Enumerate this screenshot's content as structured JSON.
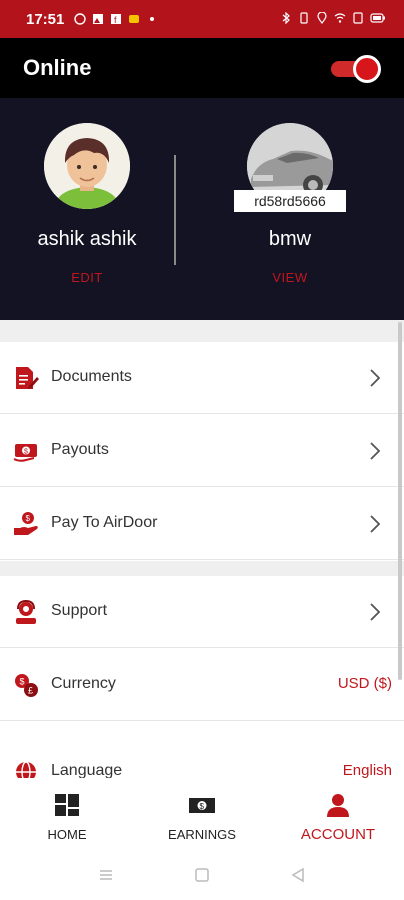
{
  "status_bar": {
    "time": "17:51",
    "left_icons": [
      "whatsapp-icon",
      "photos-icon",
      "facebook-icon",
      "message-icon",
      "dot-icon"
    ],
    "right_icons": [
      "bluetooth-icon",
      "vibrate-icon",
      "location-icon",
      "wifi-icon",
      "sim-icon",
      "battery-icon"
    ]
  },
  "header": {
    "title": "Online",
    "online_toggle": true
  },
  "profile": {
    "user_name": "ashik ashik",
    "edit_label": "EDIT",
    "car_name": "bmw",
    "plate_number": "rd58rd5666",
    "view_label": "VIEW"
  },
  "menu": {
    "group1": [
      {
        "label": "Documents",
        "icon": "document-edit-icon"
      },
      {
        "label": "Payouts",
        "icon": "payout-money-icon"
      },
      {
        "label": "Pay To AirDoor",
        "icon": "hand-pay-icon"
      }
    ],
    "group2": [
      {
        "label": "Support",
        "icon": "support-agent-icon"
      },
      {
        "label": "Currency",
        "icon": "currency-icon",
        "value": "USD ($)"
      },
      {
        "label": "Language",
        "icon": "language-icon",
        "value": "English"
      }
    ]
  },
  "bottom_nav": {
    "items": [
      {
        "label": "HOME",
        "icon": "grid-home-icon",
        "active": false
      },
      {
        "label": "EARNINGS",
        "icon": "cash-earnings-icon",
        "active": false
      },
      {
        "label": "ACCOUNT",
        "icon": "person-account-icon",
        "active": true
      }
    ]
  },
  "colors": {
    "brand_red": "#c0171d",
    "status_bar": "#b3141c",
    "profile_bg": "#131324"
  }
}
